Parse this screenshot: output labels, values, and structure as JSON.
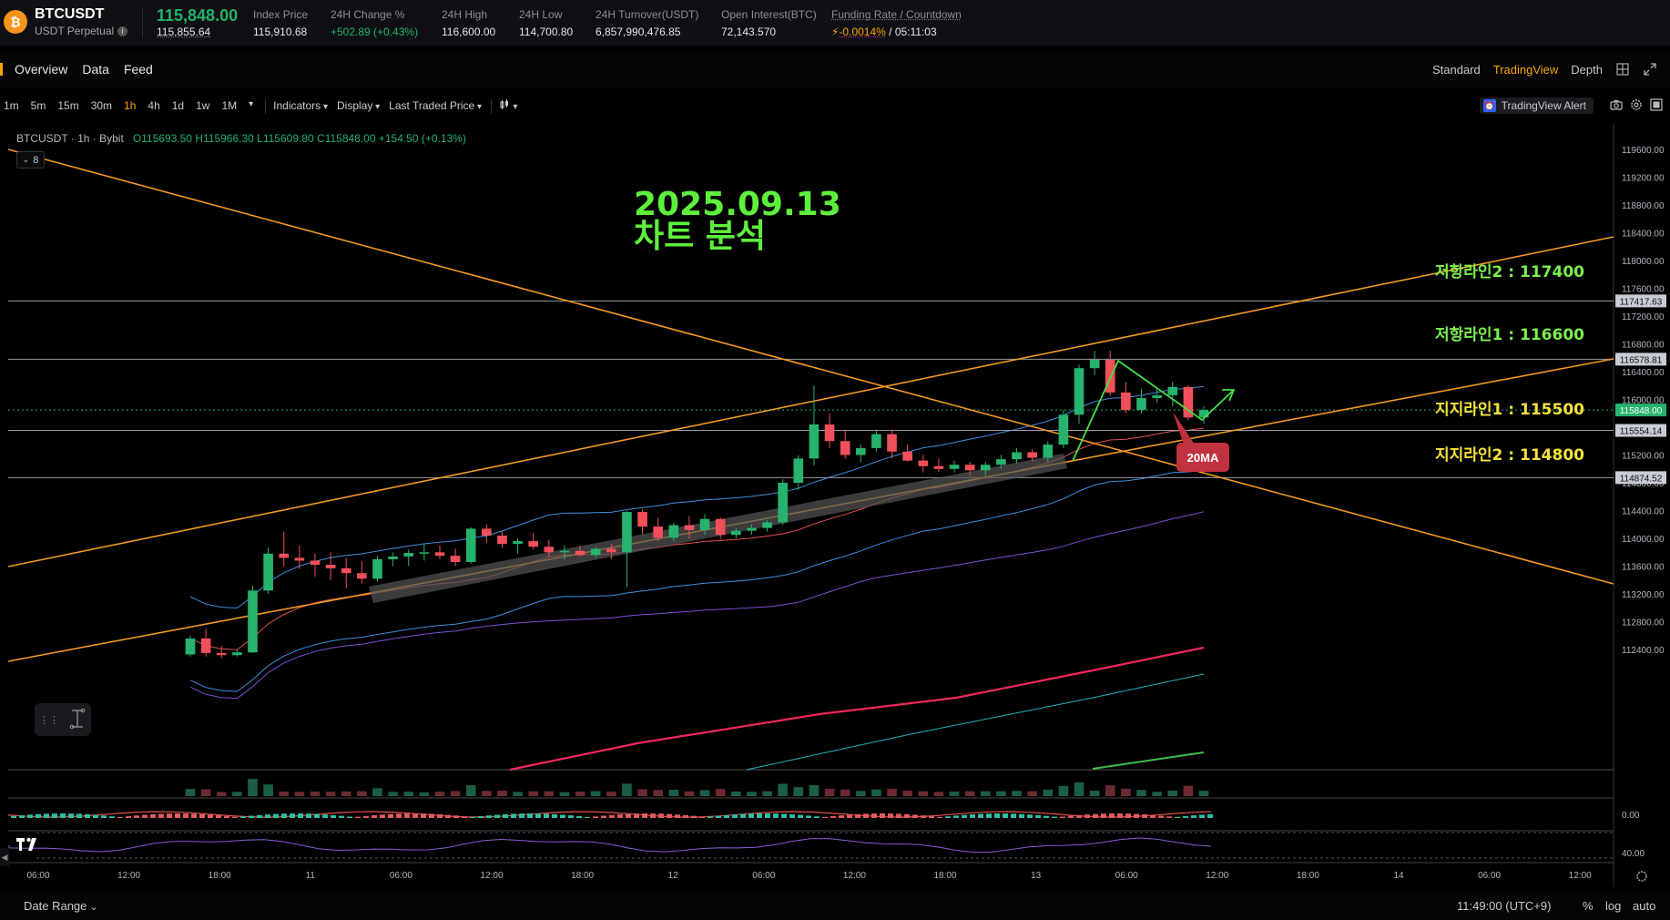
{
  "ticker": {
    "coin_glyph": "₿",
    "symbol": "BTCUSDT",
    "subtitle": "USDT Perpetual",
    "last_price": "115,848.00",
    "mark_price": "115,855.64",
    "stats": [
      {
        "label": "Index Price",
        "value": "115,910.68"
      },
      {
        "label": "24H Change %",
        "value": "+502.89 (+0.43%)"
      },
      {
        "label": "24H High",
        "value": "116,600.00"
      },
      {
        "label": "24H Low",
        "value": "114,700.80"
      },
      {
        "label": "24H Turnover(USDT)",
        "value": "6,857,990,476.85"
      },
      {
        "label": "Open Interest(BTC)",
        "value": "72,143.570"
      }
    ],
    "funding_label": "Funding Rate / Countdown",
    "funding_rate": "-0.0014%",
    "funding_countdown": "/ 05:11:03"
  },
  "nav": {
    "tabs": [
      "Overview",
      "Data",
      "Feed"
    ],
    "views": [
      "Standard",
      "TradingView",
      "Depth"
    ],
    "active_view": "TradingView"
  },
  "toolbar": {
    "timeframes": [
      "1m",
      "5m",
      "15m",
      "30m",
      "1h",
      "4h",
      "1d",
      "1w",
      "1M"
    ],
    "active_timeframe": "1h",
    "indicators": "Indicators",
    "display": "Display",
    "price_type": "Last Traded Price",
    "tv_alert": "TradingView Alert"
  },
  "legend": {
    "symbol": "BTCUSDT · 1h · Bybit",
    "open": "O115693.50",
    "high": "H115966.30",
    "low": "L115609.80",
    "close": "C115848.00",
    "change": "+154.50 (+0.13%)",
    "collapse_count": "8"
  },
  "annotations": {
    "title_line1": "2025.09.13",
    "title_line2": "차트 분석",
    "resistance2": "저항라인2 : 117400",
    "resistance1": "저항라인1 : 116600",
    "support1": "지지라인1 : 115500",
    "support2": "지지라인2 : 114800",
    "ma_badge": "20MA"
  },
  "chart_data": {
    "type": "candlestick",
    "price_ticks": [
      "119600.00",
      "119200.00",
      "118800.00",
      "118400.00",
      "118000.00",
      "117600.00",
      "117200.00",
      "116800.00",
      "116400.00",
      "116000.00",
      "115600.00",
      "115200.00",
      "114800.00",
      "114400.00",
      "114000.00",
      "113600.00",
      "113200.00",
      "112800.00",
      "112400.00"
    ],
    "price_range": [
      112100,
      119900
    ],
    "price_labels": [
      {
        "value": 117417.63,
        "text": "117417.63",
        "kind": "line"
      },
      {
        "value": 116578.81,
        "text": "116578.81",
        "kind": "line"
      },
      {
        "value": 115848.0,
        "text": "115848.00",
        "kind": "last"
      },
      {
        "value": 115554.14,
        "text": "115554.14",
        "kind": "line"
      },
      {
        "value": 114874.52,
        "text": "114874.52",
        "kind": "line"
      }
    ],
    "osc_ticks": [
      "0.00",
      "40.00"
    ],
    "time_ticks": [
      "06:00",
      "12:00",
      "18:00",
      "11",
      "06:00",
      "12:00",
      "18:00",
      "12",
      "06:00",
      "12:00",
      "18:00",
      "13",
      "06:00",
      "12:00",
      "18:00",
      "14",
      "06:00",
      "12:00"
    ],
    "candles": [
      [
        112330,
        112600,
        112300,
        112560
      ],
      [
        112560,
        112700,
        112300,
        112350
      ],
      [
        112350,
        112450,
        112280,
        112320
      ],
      [
        112320,
        112400,
        112300,
        112360
      ],
      [
        112360,
        113320,
        112350,
        113250
      ],
      [
        113250,
        113870,
        113200,
        113780
      ],
      [
        113780,
        114100,
        113600,
        113720
      ],
      [
        113720,
        113900,
        113560,
        113680
      ],
      [
        113680,
        113780,
        113450,
        113620
      ],
      [
        113620,
        113800,
        113400,
        113570
      ],
      [
        113570,
        113720,
        113280,
        113500
      ],
      [
        113500,
        113670,
        113350,
        113420
      ],
      [
        113420,
        113750,
        113380,
        113700
      ],
      [
        113700,
        113800,
        113600,
        113740
      ],
      [
        113740,
        113840,
        113600,
        113790
      ],
      [
        113790,
        113920,
        113680,
        113800
      ],
      [
        113800,
        113900,
        113700,
        113750
      ],
      [
        113750,
        113850,
        113600,
        113660
      ],
      [
        113660,
        114160,
        113640,
        114140
      ],
      [
        114140,
        114200,
        113940,
        114040
      ],
      [
        114040,
        114100,
        113860,
        113920
      ],
      [
        113920,
        114000,
        113780,
        113960
      ],
      [
        113960,
        114080,
        113840,
        113880
      ],
      [
        113880,
        113980,
        113740,
        113800
      ],
      [
        113800,
        113900,
        113700,
        113820
      ],
      [
        113820,
        113900,
        113740,
        113760
      ],
      [
        113760,
        113880,
        113720,
        113850
      ],
      [
        113850,
        113920,
        113700,
        113800
      ],
      [
        113800,
        114400,
        113300,
        114380
      ],
      [
        114380,
        114420,
        114060,
        114170
      ],
      [
        114170,
        114300,
        113960,
        114010
      ],
      [
        114010,
        114220,
        113960,
        114190
      ],
      [
        114190,
        114320,
        114000,
        114120
      ],
      [
        114120,
        114350,
        114050,
        114280
      ],
      [
        114280,
        114300,
        113990,
        114050
      ],
      [
        114050,
        114150,
        114000,
        114110
      ],
      [
        114110,
        114200,
        114050,
        114150
      ],
      [
        114150,
        114260,
        114100,
        114230
      ],
      [
        114230,
        114850,
        114200,
        114800
      ],
      [
        114800,
        115200,
        114700,
        115150
      ],
      [
        115150,
        116200,
        115050,
        115640
      ],
      [
        115640,
        115800,
        115300,
        115400
      ],
      [
        115400,
        115550,
        115150,
        115200
      ],
      [
        115200,
        115350,
        115100,
        115300
      ],
      [
        115300,
        115550,
        115250,
        115500
      ],
      [
        115500,
        115550,
        115150,
        115250
      ],
      [
        115250,
        115350,
        115100,
        115120
      ],
      [
        115120,
        115200,
        114950,
        115040
      ],
      [
        115040,
        115150,
        114960,
        115000
      ],
      [
        115000,
        115120,
        114950,
        115060
      ],
      [
        115060,
        115100,
        114900,
        114980
      ],
      [
        114980,
        115100,
        114900,
        115060
      ],
      [
        115060,
        115200,
        115000,
        115140
      ],
      [
        115140,
        115300,
        115080,
        115240
      ],
      [
        115240,
        115280,
        115100,
        115160
      ],
      [
        115160,
        115400,
        115100,
        115350
      ],
      [
        115350,
        115850,
        115300,
        115780
      ],
      [
        115780,
        116500,
        115650,
        116450
      ],
      [
        116450,
        116700,
        116350,
        116570
      ],
      [
        116570,
        116700,
        116050,
        116100
      ],
      [
        116100,
        116250,
        115800,
        115850
      ],
      [
        115850,
        116150,
        115800,
        116020
      ],
      [
        116020,
        116150,
        115950,
        116060
      ],
      [
        116060,
        116250,
        115900,
        116180
      ],
      [
        116180,
        116200,
        115700,
        115740
      ],
      [
        115740,
        115900,
        115650,
        115848
      ]
    ]
  }
}
